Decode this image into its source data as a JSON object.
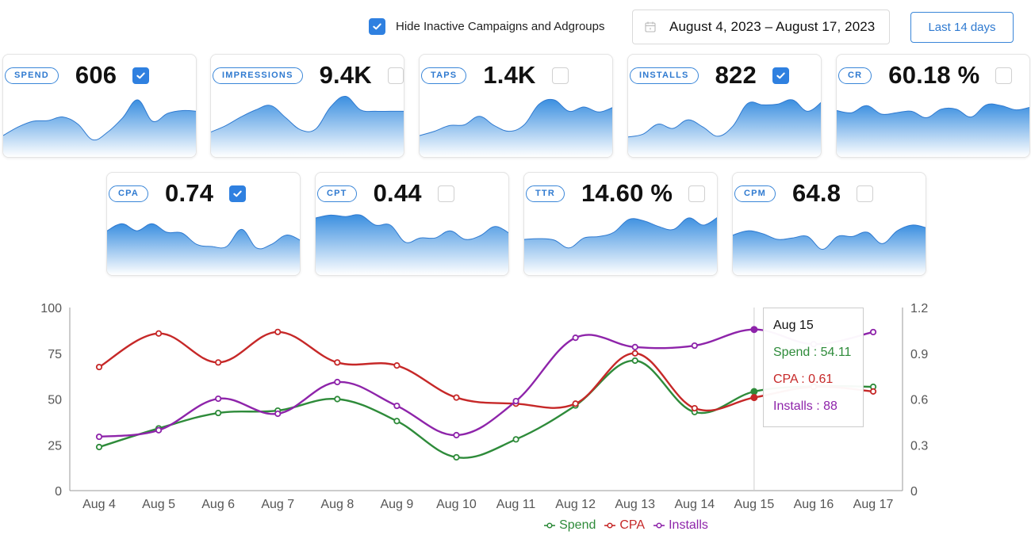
{
  "top": {
    "hide_inactive_label": "Hide Inactive Campaigns and Adgroups",
    "hide_inactive_checked": true,
    "date_range": "August 4, 2023 – August 17, 2023",
    "date_icon": "calendar-icon",
    "preset_button": "Last 14 days"
  },
  "colors": {
    "accent": "#2f80e0",
    "spend": "#2e8b3a",
    "cpa": "#c62828",
    "installs": "#8e24aa",
    "spark_line": "#2f7ad0",
    "spark_fill_top": "#3b8fe0",
    "spark_fill_bottom": "#ffffff"
  },
  "metrics": [
    {
      "key": "spend",
      "label": "SPEND",
      "value": "606",
      "checked": true,
      "spark": [
        0.3,
        0.42,
        0.5,
        0.51,
        0.56,
        0.46,
        0.24,
        0.35,
        0.55,
        0.8,
        0.5,
        0.61,
        0.65,
        0.64
      ]
    },
    {
      "key": "impressions",
      "label": "IMPRESSIONS",
      "value": "9.4K",
      "checked": false,
      "spark": [
        0.35,
        0.44,
        0.56,
        0.66,
        0.72,
        0.55,
        0.38,
        0.39,
        0.7,
        0.85,
        0.66,
        0.64,
        0.64,
        0.64
      ]
    },
    {
      "key": "taps",
      "label": "TAPS",
      "value": "1.4K",
      "checked": false,
      "spark": [
        0.3,
        0.36,
        0.44,
        0.45,
        0.57,
        0.44,
        0.36,
        0.45,
        0.74,
        0.8,
        0.64,
        0.7,
        0.63,
        0.7
      ]
    },
    {
      "key": "installs",
      "label": "INSTALLS",
      "value": "822",
      "checked": true,
      "spark": [
        0.28,
        0.32,
        0.46,
        0.4,
        0.52,
        0.42,
        0.29,
        0.43,
        0.75,
        0.73,
        0.74,
        0.8,
        0.64,
        0.78
      ]
    },
    {
      "key": "cr",
      "label": "CR",
      "value": "60.18 %",
      "checked": false,
      "spark": [
        0.65,
        0.62,
        0.72,
        0.6,
        0.62,
        0.64,
        0.55,
        0.67,
        0.67,
        0.56,
        0.73,
        0.72,
        0.66,
        0.7
      ]
    },
    {
      "key": "cpa",
      "label": "CPA",
      "value": "0.74",
      "checked": true,
      "spark": [
        0.62,
        0.72,
        0.62,
        0.72,
        0.6,
        0.59,
        0.43,
        0.4,
        0.4,
        0.64,
        0.38,
        0.43,
        0.56,
        0.48
      ]
    },
    {
      "key": "cpt",
      "label": "CPT",
      "value": "0.44",
      "checked": false,
      "spark": [
        0.8,
        0.84,
        0.82,
        0.84,
        0.7,
        0.7,
        0.46,
        0.52,
        0.52,
        0.62,
        0.5,
        0.55,
        0.68,
        0.58
      ]
    },
    {
      "key": "ttr",
      "label": "TTR",
      "value": "14.60 %",
      "checked": false,
      "spark": [
        0.5,
        0.51,
        0.49,
        0.38,
        0.52,
        0.54,
        0.6,
        0.78,
        0.76,
        0.68,
        0.64,
        0.8,
        0.7,
        0.82
      ]
    },
    {
      "key": "cpm",
      "label": "CPM",
      "value": "64.8",
      "checked": false,
      "spark": [
        0.56,
        0.62,
        0.58,
        0.5,
        0.52,
        0.54,
        0.36,
        0.54,
        0.54,
        0.6,
        0.44,
        0.62,
        0.7,
        0.66
      ]
    }
  ],
  "tooltip": {
    "date": "Aug 15",
    "spend": "Spend : 54.11",
    "cpa": "CPA : 0.61",
    "installs": "Installs : 88"
  },
  "chart_data": {
    "type": "line",
    "title": "",
    "xlabel": "",
    "ylabel": "",
    "categories": [
      "Aug 4",
      "Aug 5",
      "Aug 6",
      "Aug 7",
      "Aug 8",
      "Aug 9",
      "Aug 10",
      "Aug 11",
      "Aug 12",
      "Aug 13",
      "Aug 14",
      "Aug 15",
      "Aug 16",
      "Aug 17"
    ],
    "y_left": {
      "range": [
        0,
        100
      ],
      "ticks": [
        "0",
        "25",
        "50",
        "75",
        "100"
      ]
    },
    "y_right": {
      "range": [
        0,
        1.2
      ],
      "ticks": [
        "0",
        "0.3",
        "0.6",
        "0.9",
        "1.2"
      ]
    },
    "grid": false,
    "legend_position": "bottom",
    "highlight_category": "Aug 15",
    "series": [
      {
        "name": "Spend",
        "axis": "left",
        "color": "#2e8b3a",
        "values": [
          23.8,
          34.0,
          42.4,
          43.7,
          50.0,
          38.0,
          18.2,
          28.0,
          46.5,
          71.0,
          42.9,
          54.11,
          57.0,
          56.7
        ]
      },
      {
        "name": "CPA",
        "axis": "right",
        "color": "#c62828",
        "values": [
          0.81,
          1.03,
          0.84,
          1.04,
          0.84,
          0.82,
          0.61,
          0.57,
          0.57,
          0.9,
          0.54,
          0.61,
          0.68,
          0.65
        ]
      },
      {
        "name": "Installs",
        "axis": "left",
        "color": "#8e24aa",
        "values": [
          29.4,
          33.0,
          50.2,
          42.0,
          59.3,
          46.3,
          30.3,
          48.9,
          83.5,
          78.4,
          79.2,
          88.0,
          80.0,
          86.6
        ]
      }
    ]
  }
}
